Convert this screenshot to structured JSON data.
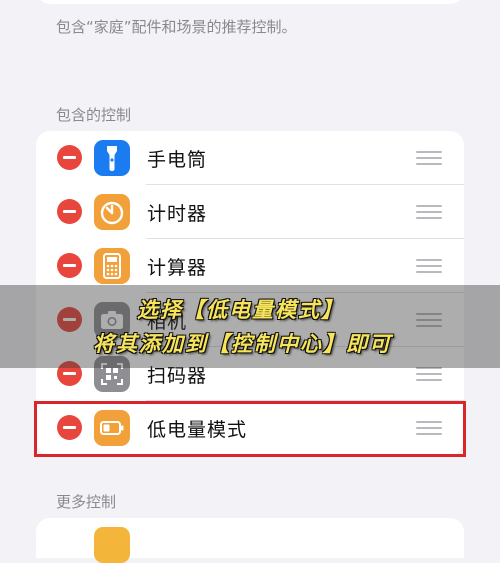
{
  "home_hint": "包含“家庭”配件和场景的推荐控制。",
  "included_section": {
    "header": "包含的控制",
    "items": [
      {
        "label": "手电筒",
        "icon": "flashlight-icon",
        "icon_color": "#1a7cf0"
      },
      {
        "label": "计时器",
        "icon": "timer-icon",
        "icon_color": "#f2a03a"
      },
      {
        "label": "计算器",
        "icon": "calculator-icon",
        "icon_color": "#f2a03a"
      },
      {
        "label": "相机",
        "icon": "camera-icon",
        "icon_color": "#8e8e93"
      },
      {
        "label": "扫码器",
        "icon": "qr-scanner-icon",
        "icon_color": "#8e8e93"
      },
      {
        "label": "低电量模式",
        "icon": "low-power-icon",
        "icon_color": "#f2a03a"
      }
    ]
  },
  "more_section": {
    "header": "更多控制"
  },
  "overlay_caption": {
    "line1": "选择【低电量模式】",
    "line2": "将其添加到【控制中心】即可"
  },
  "colors": {
    "remove_red": "#e8463c",
    "highlight_red": "#d8262a",
    "caption_yellow": "#f6e45a"
  }
}
